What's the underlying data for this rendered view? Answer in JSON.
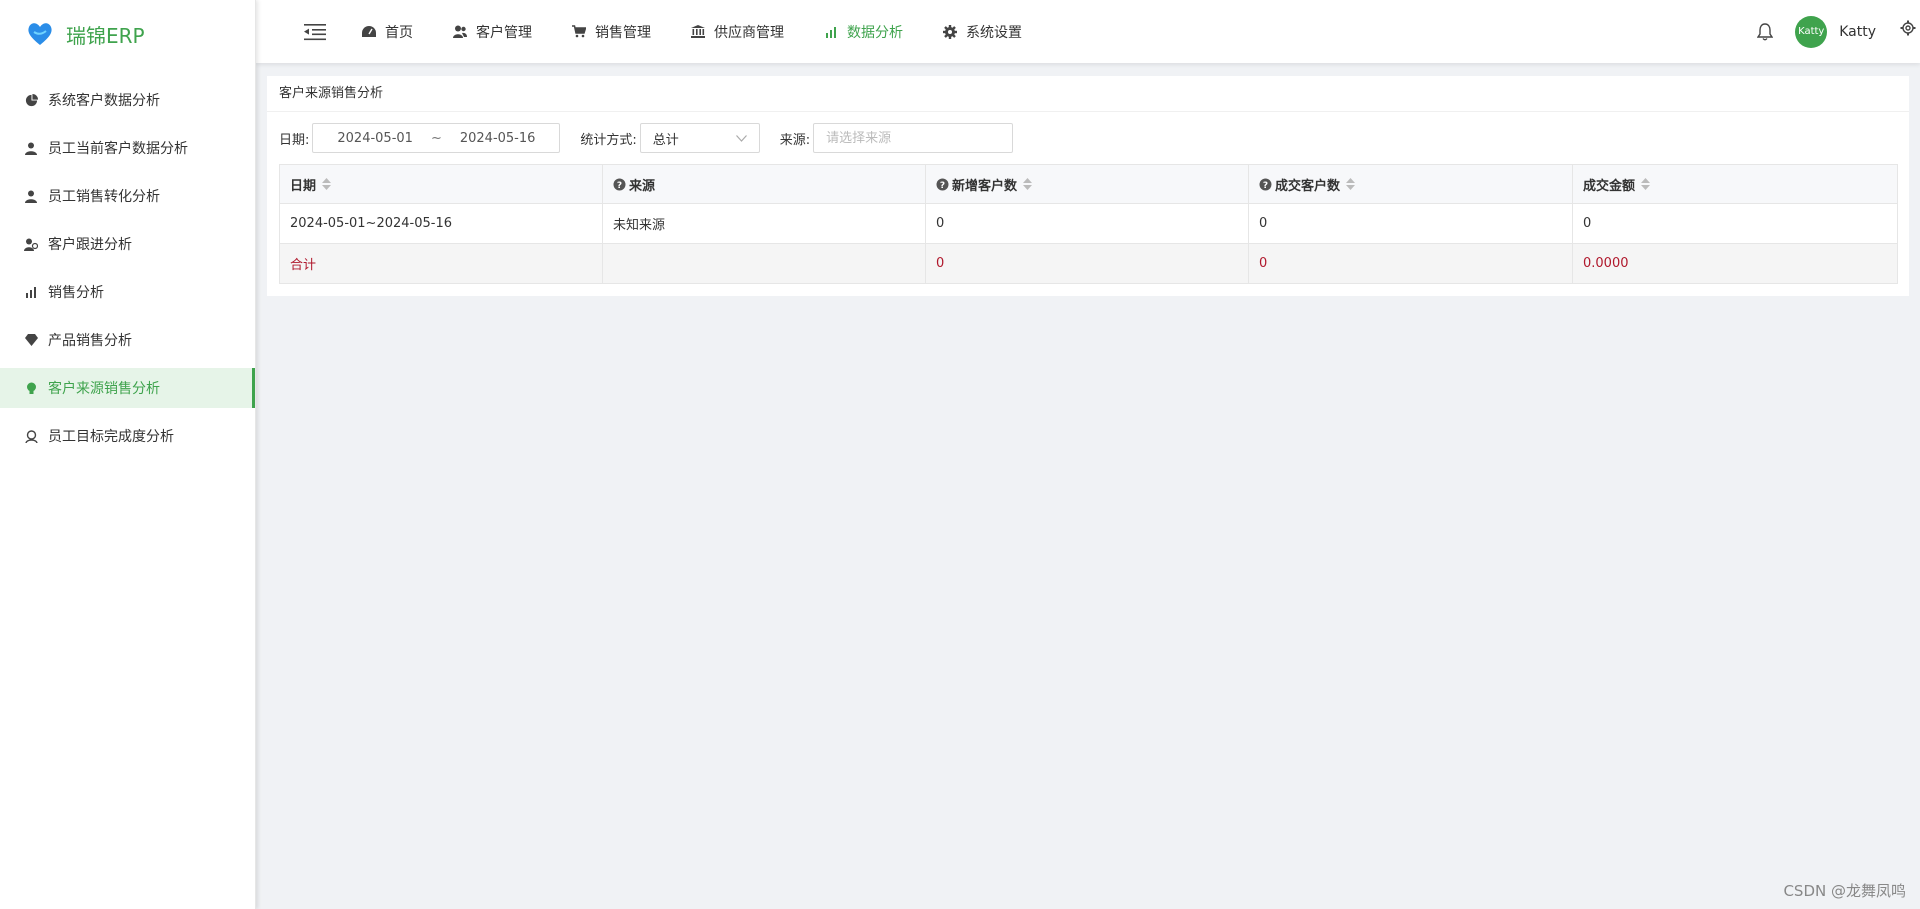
{
  "app": {
    "name": "瑞锦ERP",
    "brand_color": "#3fa34d",
    "total_color": "#b0182c"
  },
  "sidebar": {
    "items": [
      {
        "label": "系统客户数据分析",
        "icon": "pie-chart-icon"
      },
      {
        "label": "员工当前客户数据分析",
        "icon": "user-icon"
      },
      {
        "label": "员工销售转化分析",
        "icon": "user-icon"
      },
      {
        "label": "客户跟进分析",
        "icon": "user-follow-icon"
      },
      {
        "label": "销售分析",
        "icon": "bar-chart-icon"
      },
      {
        "label": "产品销售分析",
        "icon": "diamond-icon"
      },
      {
        "label": "客户来源销售分析",
        "icon": "bulb-icon",
        "active": true
      },
      {
        "label": "员工目标完成度分析",
        "icon": "target-user-icon"
      }
    ]
  },
  "header": {
    "nav": [
      {
        "label": "首页",
        "icon": "dashboard-icon"
      },
      {
        "label": "客户管理",
        "icon": "users-icon"
      },
      {
        "label": "销售管理",
        "icon": "cart-icon"
      },
      {
        "label": "供应商管理",
        "icon": "bank-icon"
      },
      {
        "label": "数据分析",
        "icon": "bar-chart-icon",
        "active": true
      },
      {
        "label": "系统设置",
        "icon": "gear-icon"
      }
    ],
    "avatar_text": "Katty",
    "username": "Katty"
  },
  "page": {
    "title": "客户来源销售分析",
    "filters": {
      "date_label": "日期:",
      "date_start": "2024-05-01",
      "date_sep": "~",
      "date_end": "2024-05-16",
      "method_label": "统计方式:",
      "method_value": "总计",
      "source_label": "来源:",
      "source_placeholder": "请选择来源"
    },
    "table": {
      "headers": [
        "日期",
        "来源",
        "新增客户数",
        "成交客户数",
        "成交金额"
      ],
      "rows": [
        [
          "2024-05-01~2024-05-16",
          "未知来源",
          "0",
          "0",
          "0"
        ]
      ],
      "total": [
        "合计",
        "",
        "0",
        "0",
        "0.0000"
      ]
    }
  },
  "watermark": "CSDN @龙舞凤鸣"
}
